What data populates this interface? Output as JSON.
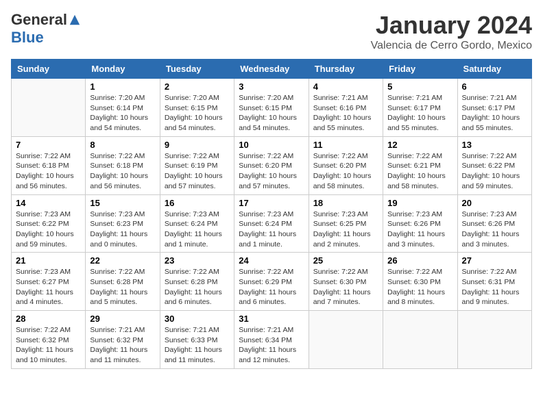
{
  "header": {
    "logo_general": "General",
    "logo_blue": "Blue",
    "month": "January 2024",
    "location": "Valencia de Cerro Gordo, Mexico"
  },
  "days_of_week": [
    "Sunday",
    "Monday",
    "Tuesday",
    "Wednesday",
    "Thursday",
    "Friday",
    "Saturday"
  ],
  "weeks": [
    [
      {
        "day": "",
        "info": ""
      },
      {
        "day": "1",
        "info": "Sunrise: 7:20 AM\nSunset: 6:14 PM\nDaylight: 10 hours\nand 54 minutes."
      },
      {
        "day": "2",
        "info": "Sunrise: 7:20 AM\nSunset: 6:15 PM\nDaylight: 10 hours\nand 54 minutes."
      },
      {
        "day": "3",
        "info": "Sunrise: 7:20 AM\nSunset: 6:15 PM\nDaylight: 10 hours\nand 54 minutes."
      },
      {
        "day": "4",
        "info": "Sunrise: 7:21 AM\nSunset: 6:16 PM\nDaylight: 10 hours\nand 55 minutes."
      },
      {
        "day": "5",
        "info": "Sunrise: 7:21 AM\nSunset: 6:17 PM\nDaylight: 10 hours\nand 55 minutes."
      },
      {
        "day": "6",
        "info": "Sunrise: 7:21 AM\nSunset: 6:17 PM\nDaylight: 10 hours\nand 55 minutes."
      }
    ],
    [
      {
        "day": "7",
        "info": "Sunrise: 7:22 AM\nSunset: 6:18 PM\nDaylight: 10 hours\nand 56 minutes."
      },
      {
        "day": "8",
        "info": "Sunrise: 7:22 AM\nSunset: 6:18 PM\nDaylight: 10 hours\nand 56 minutes."
      },
      {
        "day": "9",
        "info": "Sunrise: 7:22 AM\nSunset: 6:19 PM\nDaylight: 10 hours\nand 57 minutes."
      },
      {
        "day": "10",
        "info": "Sunrise: 7:22 AM\nSunset: 6:20 PM\nDaylight: 10 hours\nand 57 minutes."
      },
      {
        "day": "11",
        "info": "Sunrise: 7:22 AM\nSunset: 6:20 PM\nDaylight: 10 hours\nand 58 minutes."
      },
      {
        "day": "12",
        "info": "Sunrise: 7:22 AM\nSunset: 6:21 PM\nDaylight: 10 hours\nand 58 minutes."
      },
      {
        "day": "13",
        "info": "Sunrise: 7:22 AM\nSunset: 6:22 PM\nDaylight: 10 hours\nand 59 minutes."
      }
    ],
    [
      {
        "day": "14",
        "info": "Sunrise: 7:23 AM\nSunset: 6:22 PM\nDaylight: 10 hours\nand 59 minutes."
      },
      {
        "day": "15",
        "info": "Sunrise: 7:23 AM\nSunset: 6:23 PM\nDaylight: 11 hours\nand 0 minutes."
      },
      {
        "day": "16",
        "info": "Sunrise: 7:23 AM\nSunset: 6:24 PM\nDaylight: 11 hours\nand 1 minute."
      },
      {
        "day": "17",
        "info": "Sunrise: 7:23 AM\nSunset: 6:24 PM\nDaylight: 11 hours\nand 1 minute."
      },
      {
        "day": "18",
        "info": "Sunrise: 7:23 AM\nSunset: 6:25 PM\nDaylight: 11 hours\nand 2 minutes."
      },
      {
        "day": "19",
        "info": "Sunrise: 7:23 AM\nSunset: 6:26 PM\nDaylight: 11 hours\nand 3 minutes."
      },
      {
        "day": "20",
        "info": "Sunrise: 7:23 AM\nSunset: 6:26 PM\nDaylight: 11 hours\nand 3 minutes."
      }
    ],
    [
      {
        "day": "21",
        "info": "Sunrise: 7:23 AM\nSunset: 6:27 PM\nDaylight: 11 hours\nand 4 minutes."
      },
      {
        "day": "22",
        "info": "Sunrise: 7:22 AM\nSunset: 6:28 PM\nDaylight: 11 hours\nand 5 minutes."
      },
      {
        "day": "23",
        "info": "Sunrise: 7:22 AM\nSunset: 6:28 PM\nDaylight: 11 hours\nand 6 minutes."
      },
      {
        "day": "24",
        "info": "Sunrise: 7:22 AM\nSunset: 6:29 PM\nDaylight: 11 hours\nand 6 minutes."
      },
      {
        "day": "25",
        "info": "Sunrise: 7:22 AM\nSunset: 6:30 PM\nDaylight: 11 hours\nand 7 minutes."
      },
      {
        "day": "26",
        "info": "Sunrise: 7:22 AM\nSunset: 6:30 PM\nDaylight: 11 hours\nand 8 minutes."
      },
      {
        "day": "27",
        "info": "Sunrise: 7:22 AM\nSunset: 6:31 PM\nDaylight: 11 hours\nand 9 minutes."
      }
    ],
    [
      {
        "day": "28",
        "info": "Sunrise: 7:22 AM\nSunset: 6:32 PM\nDaylight: 11 hours\nand 10 minutes."
      },
      {
        "day": "29",
        "info": "Sunrise: 7:21 AM\nSunset: 6:32 PM\nDaylight: 11 hours\nand 11 minutes."
      },
      {
        "day": "30",
        "info": "Sunrise: 7:21 AM\nSunset: 6:33 PM\nDaylight: 11 hours\nand 11 minutes."
      },
      {
        "day": "31",
        "info": "Sunrise: 7:21 AM\nSunset: 6:34 PM\nDaylight: 11 hours\nand 12 minutes."
      },
      {
        "day": "",
        "info": ""
      },
      {
        "day": "",
        "info": ""
      },
      {
        "day": "",
        "info": ""
      }
    ]
  ]
}
